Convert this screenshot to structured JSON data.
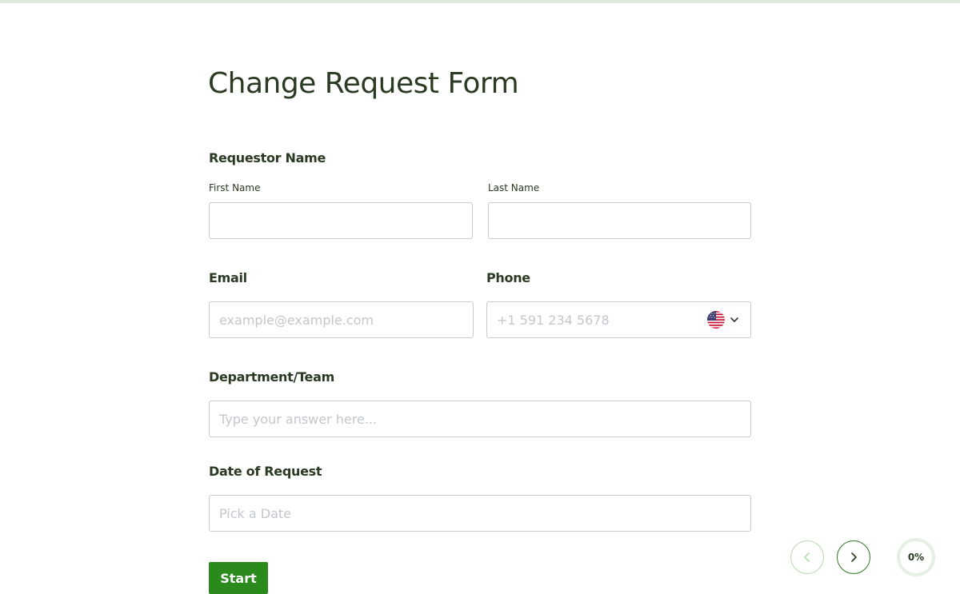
{
  "form": {
    "title": "Change Request Form"
  },
  "requestor_name": {
    "label": "Requestor Name",
    "first_name_label": "First Name",
    "first_name_value": "",
    "last_name_label": "Last Name",
    "last_name_value": ""
  },
  "email": {
    "label": "Email",
    "placeholder": "example@example.com",
    "value": ""
  },
  "phone": {
    "label": "Phone",
    "placeholder": "+1 591 234 5678",
    "value": "",
    "country_flag_icon": "us-flag-icon",
    "dropdown_icon": "chevron-down-icon"
  },
  "department": {
    "label": "Department/Team",
    "placeholder": "Type your answer here...",
    "value": ""
  },
  "date_of_request": {
    "label": "Date of Request",
    "placeholder": "Pick a Date",
    "value": ""
  },
  "actions": {
    "start_label": "Start",
    "prev_icon": "chevron-left-icon",
    "next_icon": "chevron-right-icon"
  },
  "progress": {
    "value": 0,
    "label": "0%"
  },
  "colors": {
    "accent": "#2a8a1c",
    "text": "#2b3a22",
    "border": "#c8ccc6",
    "placeholder": "#c3c7cc",
    "top_bar": "#dfeadb"
  }
}
